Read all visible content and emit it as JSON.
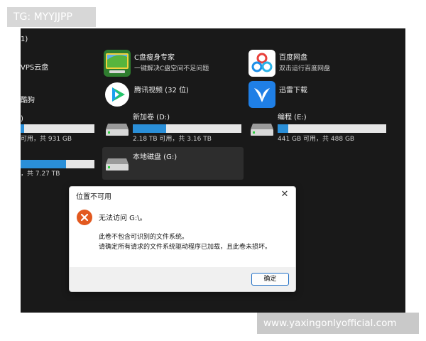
{
  "watermarks": {
    "top": "TG: MYYJJPP",
    "bottom": "www.yaxingonlyofficial.com"
  },
  "explorer": {
    "section_header_fragment": "1)",
    "left_column": {
      "item1_fragment": "VPS云盘",
      "item2_fragment": "酷狗",
      "drive1_fragment": ")",
      "drive1_free_fragment": "可用，共 931 GB",
      "drive1_usage": 0.05,
      "drive2_free_fragment": "，共 7.27 TB",
      "drive2_usage": 0.62
    },
    "apps": [
      {
        "title": "C盘瘦身专家",
        "subtitle": "一键解决C盘空间不足问题",
        "icon": "c-drive-cleaner-icon"
      },
      {
        "title": "百度网盘",
        "subtitle": "双击运行百度网盘",
        "icon": "baidu-netdisk-icon"
      },
      {
        "title": "腾讯视频 (32 位)",
        "subtitle": "",
        "icon": "tencent-video-icon"
      },
      {
        "title": "迅雷下载",
        "subtitle": "",
        "icon": "xunlei-icon"
      }
    ],
    "drives": [
      {
        "label": "新加卷 (D:)",
        "free_text": "2.18 TB 可用，共 3.16 TB",
        "usage": 0.31,
        "icon": "hard-drive-icon"
      },
      {
        "label": "编程 (E:)",
        "free_text": "441 GB 可用，共 488 GB",
        "usage": 0.1,
        "icon": "hard-drive-icon"
      },
      {
        "label": "本地磁盘 (G:)",
        "free_text": "",
        "usage": null,
        "icon": "hard-drive-icon"
      }
    ]
  },
  "dialog": {
    "title": "位置不可用",
    "close_glyph": "✕",
    "message": "无法访问 G:\\。",
    "detail_line1": "此卷不包含可识别的文件系统。",
    "detail_line2": "请确定所有请求的文件系统驱动程序已加载，且此卷未损坏。",
    "ok_label": "确定",
    "error_icon": "error-x-icon"
  },
  "colors": {
    "explorer_bg": "#191919",
    "bar_fill": "#2a8fd8",
    "bar_track": "#e6e6e6",
    "error_red": "#e2591f",
    "button_border": "#1f6fc6"
  }
}
